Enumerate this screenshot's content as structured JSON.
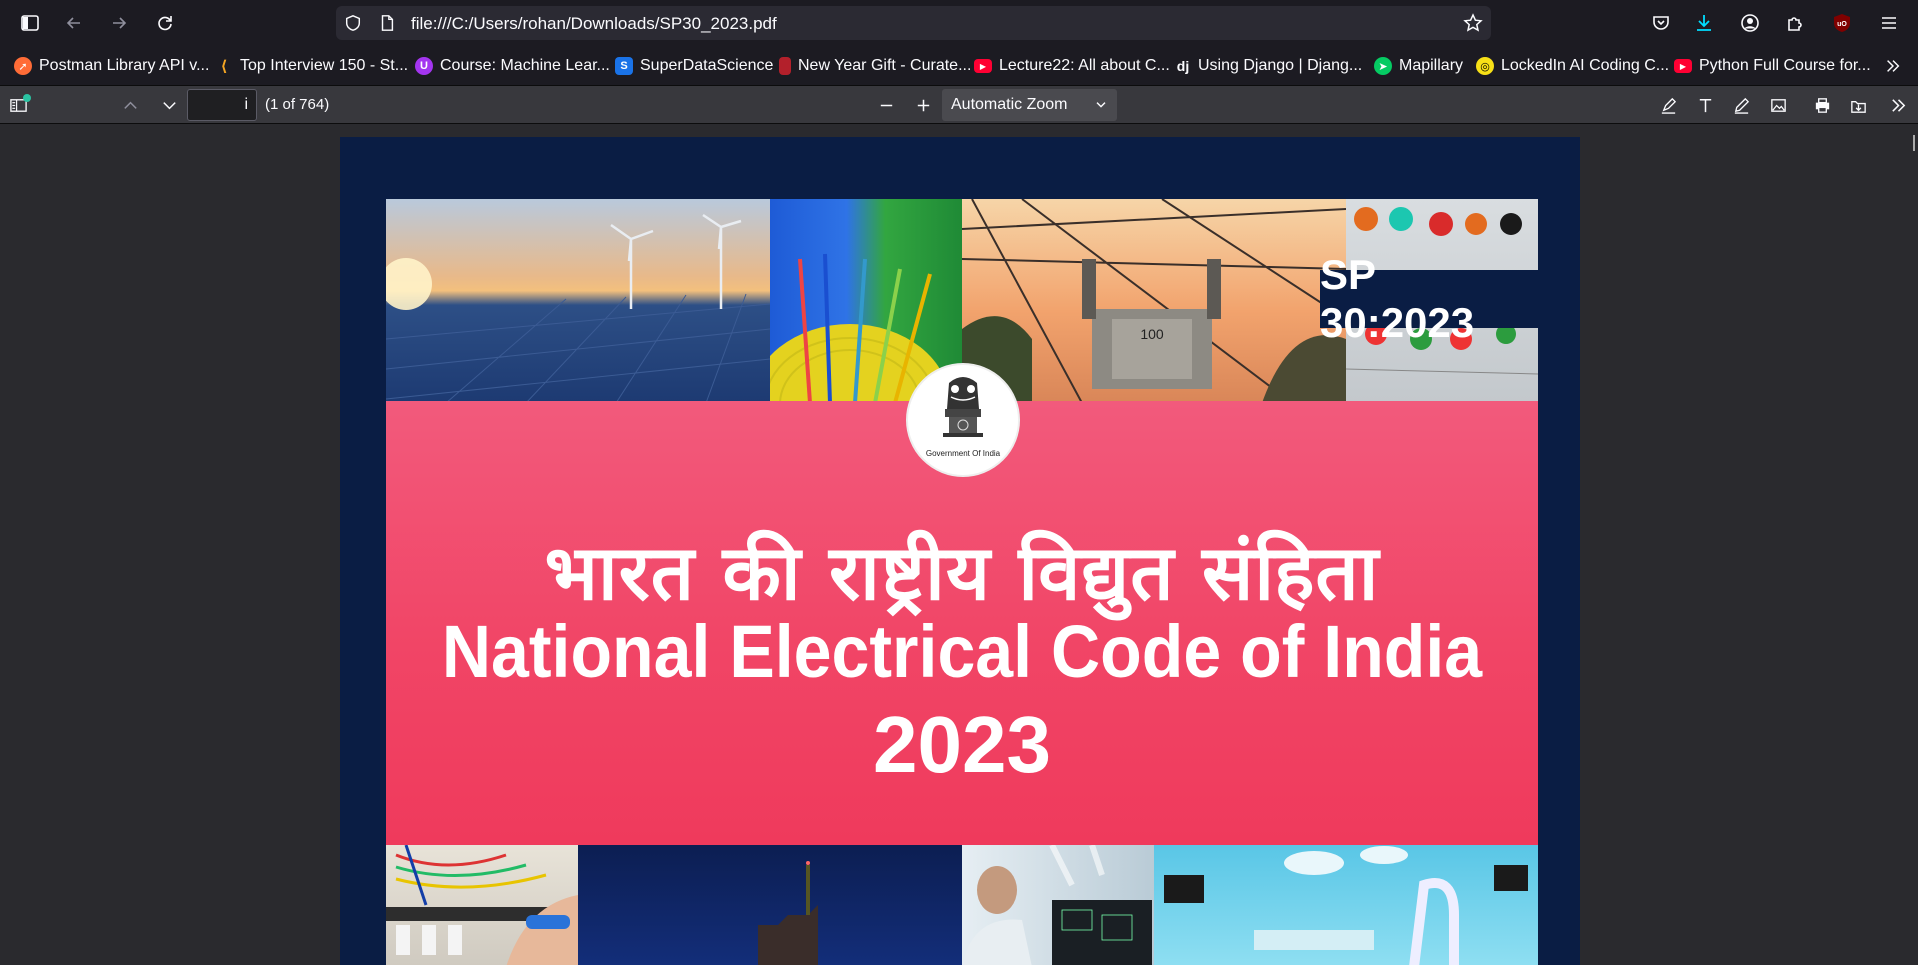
{
  "browser": {
    "url": "file:///C:/Users/rohan/Downloads/SP30_2023.pdf"
  },
  "bookmarks": [
    {
      "label": "Postman Library API v...",
      "color": "#ff6c37"
    },
    {
      "label": "Top Interview 150 - St...",
      "color": "#f5a623"
    },
    {
      "label": "Course: Machine Lear...",
      "color": "#a435f0"
    },
    {
      "label": "SuperDataScience",
      "color": "#1a73e8",
      "glyph": "S"
    },
    {
      "label": "New Year Gift - Curate...",
      "color": "#b3202b"
    },
    {
      "label": "Lecture22: All about C...",
      "color": "#ff0033"
    },
    {
      "label": "Using Django | Djang...",
      "color": "#0c4b33",
      "glyph": "dj"
    },
    {
      "label": "Mapillary",
      "color": "#05cb63"
    },
    {
      "label": "LockedIn AI Coding C...",
      "color": "#f7e017"
    },
    {
      "label": "Python Full Course for...",
      "color": "#ff0033"
    }
  ],
  "pdf_toolbar": {
    "page_input": "i",
    "page_count": "(1 of 764)",
    "zoom": "Automatic Zoom"
  },
  "document": {
    "badge": "SP 30:2023",
    "title_hindi": "भारत की राष्ट्रीय विद्युत संहिता",
    "title_english": "National Electrical Code of India",
    "year": "2023",
    "emblem_caption": "Government Of India",
    "band_color": "#f2476a",
    "cover_color": "#0a1d44"
  },
  "theme": {
    "accent_download": "#00ddff",
    "ublock": "#800000"
  }
}
